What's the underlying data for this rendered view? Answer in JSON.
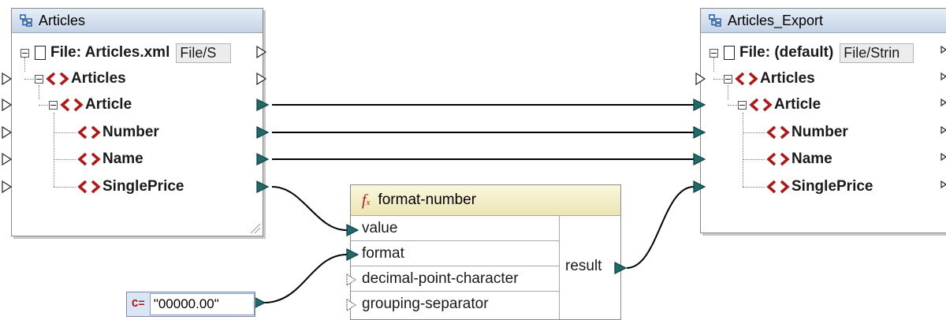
{
  "source": {
    "title": "Articles",
    "file_label": "File: Articles.xml",
    "file_button": "File/S",
    "nodes": [
      "Articles",
      "Article",
      "Number",
      "Name",
      "SinglePrice"
    ]
  },
  "target": {
    "title": "Articles_Export",
    "file_label": "File: (default)",
    "file_button": "File/Strin",
    "nodes": [
      "Articles",
      "Article",
      "Number",
      "Name",
      "SinglePrice"
    ]
  },
  "function": {
    "name": "format-number",
    "params": [
      "value",
      "format",
      "decimal-point-character",
      "grouping-separator"
    ],
    "output": "result"
  },
  "constant": {
    "icon_label": "C=",
    "value": "\"00000.00\""
  },
  "colors": {
    "connector": "#1f6b6b",
    "element_icon": "#b01818",
    "component_header": "#c4d3e6",
    "function_header": "#ece5b3"
  }
}
